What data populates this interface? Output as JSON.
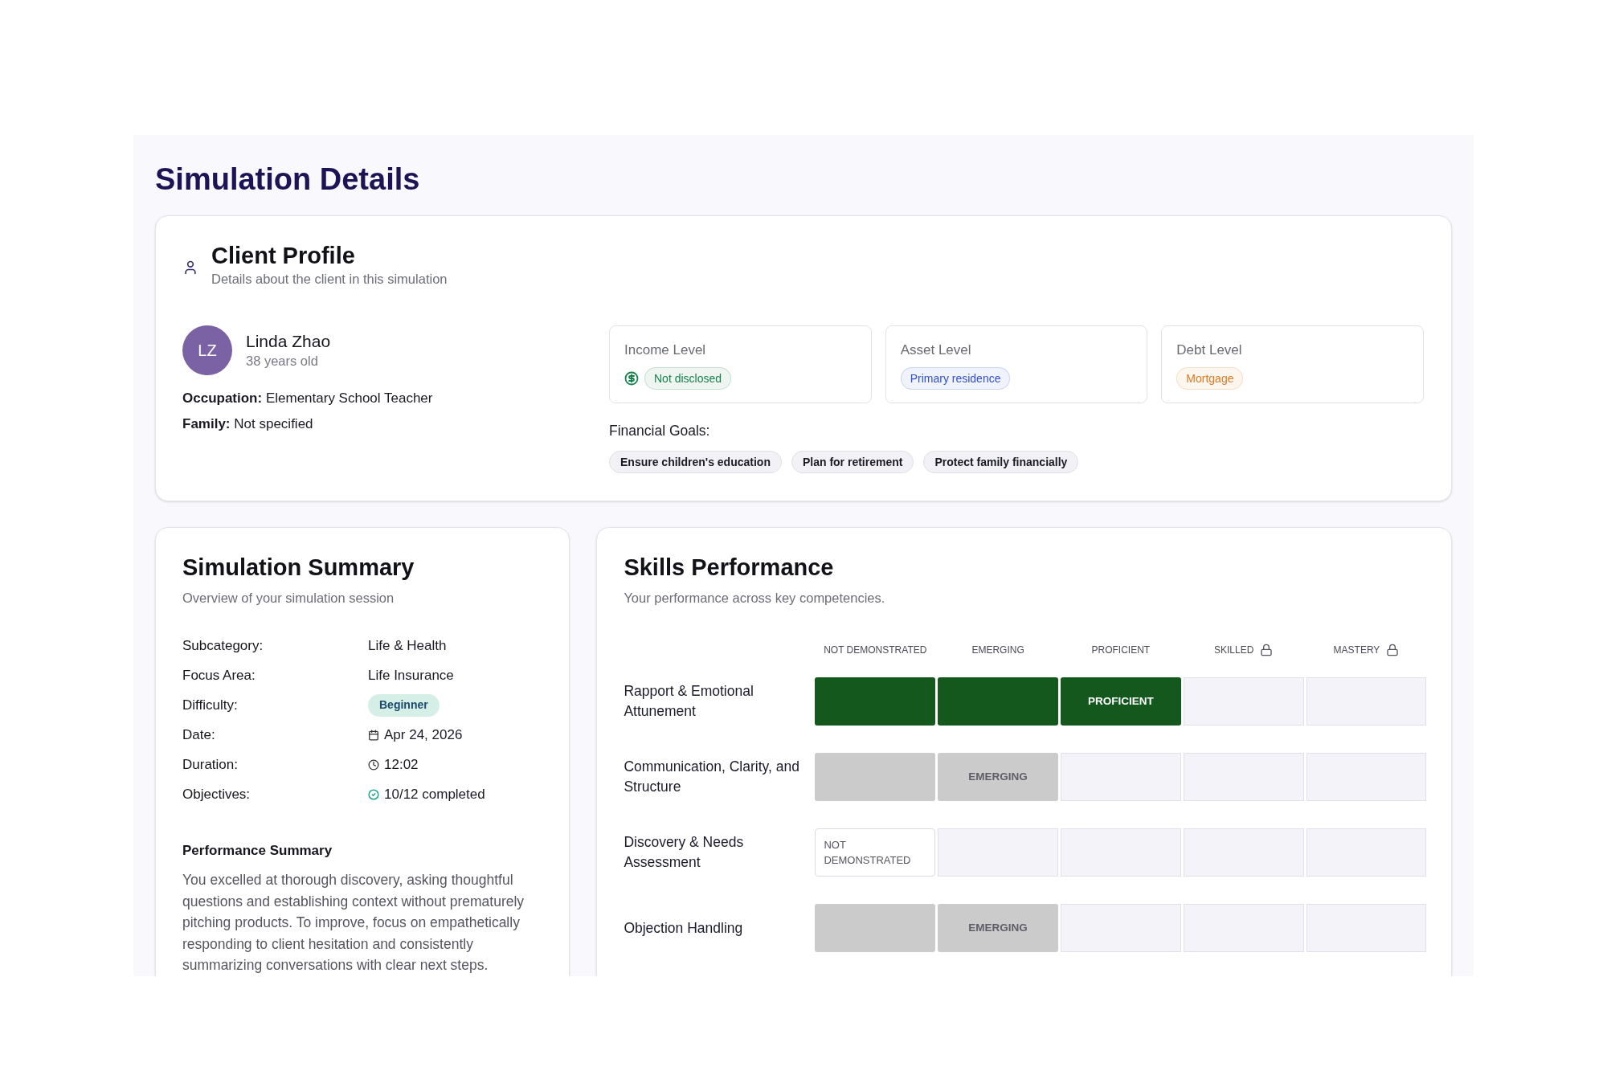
{
  "page": {
    "title": "Simulation Details"
  },
  "client_profile": {
    "title": "Client Profile",
    "subtitle": "Details about the client in this simulation",
    "client": {
      "initials": "LZ",
      "name": "Linda Zhao",
      "age": "38 years old",
      "details": [
        {
          "label": "Occupation:",
          "value": "Elementary School Teacher"
        },
        {
          "label": "Family:",
          "value": "Not specified"
        }
      ]
    },
    "levels": [
      {
        "label": "Income Level",
        "value": "Not disclosed",
        "kind": "icon_badge",
        "color": "#17804a"
      },
      {
        "label": "Asset Level",
        "value": "Primary residence",
        "kind": "badge",
        "color": "#2f4fcf"
      },
      {
        "label": "Debt Level",
        "value": "Mortgage",
        "kind": "badge",
        "color": "#d97a22"
      }
    ],
    "financial_goals": {
      "label": "Financial Goals:",
      "items": [
        "Ensure children's education",
        "Plan for retirement",
        "Protect family financially"
      ]
    }
  },
  "simulation_summary": {
    "title": "Simulation Summary",
    "subtitle": "Overview of your simulation session",
    "rows": [
      {
        "label": "Subcategory:",
        "value": "Life & Health",
        "kind": "text"
      },
      {
        "label": "Focus Area:",
        "value": "Life Insurance",
        "kind": "text"
      },
      {
        "label": "Difficulty:",
        "value": "Beginner",
        "kind": "badge"
      },
      {
        "label": "Date:",
        "value": "Apr 24, 2026",
        "kind": "date"
      },
      {
        "label": "Duration:",
        "value": "12:02",
        "kind": "time"
      },
      {
        "label": "Objectives:",
        "value": "10/12 completed",
        "kind": "check"
      }
    ],
    "performance_summary": {
      "title": "Performance Summary",
      "text": "You excelled at thorough discovery, asking thoughtful questions and establishing context without prematurely pitching products. To improve, focus on empathetically responding to client hesitation and consistently summarizing conversations with clear next steps."
    }
  },
  "skills_performance": {
    "title": "Skills Performance",
    "subtitle": "Your performance across key competencies.",
    "columns": [
      {
        "label": "NOT DEMONSTRATED",
        "locked": false
      },
      {
        "label": "EMERGING",
        "locked": false
      },
      {
        "label": "PROFICIENT",
        "locked": false
      },
      {
        "label": "SKILLED",
        "locked": true
      },
      {
        "label": "MASTERY",
        "locked": true
      }
    ],
    "rows": [
      {
        "name": "Rapport & Emotional Attunement",
        "color": "#14581e",
        "cells": [
          {
            "kind": "filled"
          },
          {
            "kind": "filled"
          },
          {
            "kind": "current",
            "label": "PROFICIENT"
          },
          {
            "kind": "empty"
          },
          {
            "kind": "empty"
          }
        ]
      },
      {
        "name": "Communication, Clarity, and Structure",
        "color": "#cbcbcb",
        "cells": [
          {
            "kind": "filled"
          },
          {
            "kind": "current",
            "label": "EMERGING"
          },
          {
            "kind": "empty"
          },
          {
            "kind": "empty"
          },
          {
            "kind": "empty"
          }
        ]
      },
      {
        "name": "Discovery & Needs Assessment",
        "cells": [
          {
            "kind": "outline",
            "label": "NOT DEMONSTRATED"
          },
          {
            "kind": "empty"
          },
          {
            "kind": "empty"
          },
          {
            "kind": "empty"
          },
          {
            "kind": "empty"
          }
        ]
      },
      {
        "name": "Objection Handling",
        "color": "#cbcbcb",
        "cells": [
          {
            "kind": "filled"
          },
          {
            "kind": "current",
            "label": "EMERGING"
          },
          {
            "kind": "empty"
          },
          {
            "kind": "empty"
          },
          {
            "kind": "empty"
          }
        ]
      }
    ]
  }
}
